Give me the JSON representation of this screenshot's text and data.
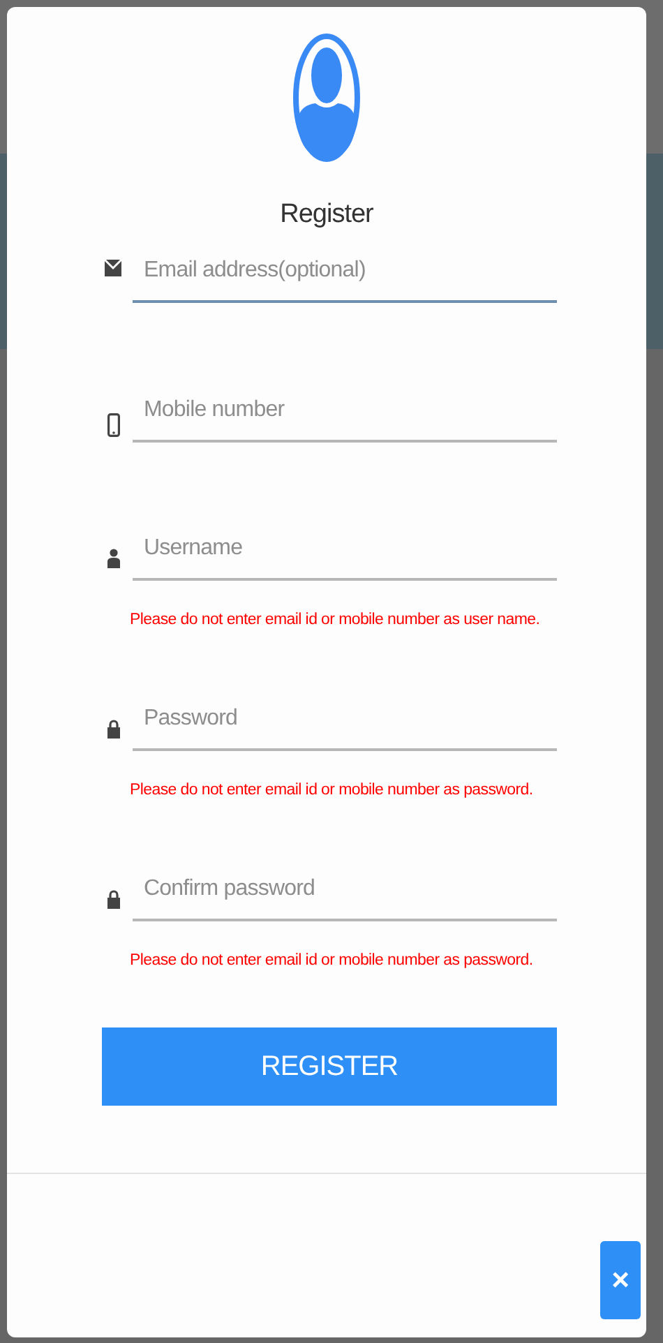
{
  "dialog": {
    "title": "Register",
    "fields": [
      {
        "kind": "email",
        "placeholder": "Email address(optional)",
        "focused": true
      },
      {
        "kind": "mobile",
        "placeholder": "Mobile number",
        "focused": false
      },
      {
        "kind": "user",
        "placeholder": "Username",
        "focused": false,
        "hint": "Please do not enter email id or mobile number as user name."
      },
      {
        "kind": "lock",
        "placeholder": "Password",
        "focused": false,
        "hint": "Please do not enter email id or mobile number as password."
      },
      {
        "kind": "lock",
        "placeholder": "Confirm password",
        "focused": false,
        "hint": "Please do not enter email id or mobile number as password."
      }
    ],
    "submit": "REGISTER",
    "close": "×"
  }
}
